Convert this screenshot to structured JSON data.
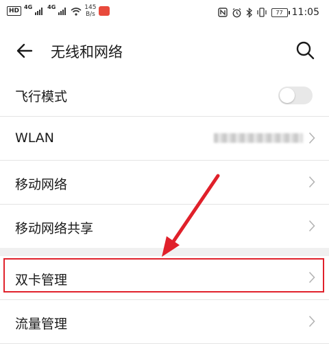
{
  "statusbar": {
    "hd": "HD",
    "net1": "4G",
    "net2": "4G",
    "speed_value": "145",
    "speed_unit": "B/s",
    "battery": "77",
    "time": "11:05"
  },
  "header": {
    "title": "无线和网络"
  },
  "settings": {
    "airplane_label": "飞行模式",
    "airplane_on": false,
    "wlan_label": "WLAN",
    "mobile_network_label": "移动网络",
    "tethering_label": "移动网络共享",
    "dual_sim_label": "双卡管理",
    "data_usage_label": "流量管理"
  },
  "colors": {
    "highlight": "#e0202a",
    "background": "#f3f3f3"
  }
}
